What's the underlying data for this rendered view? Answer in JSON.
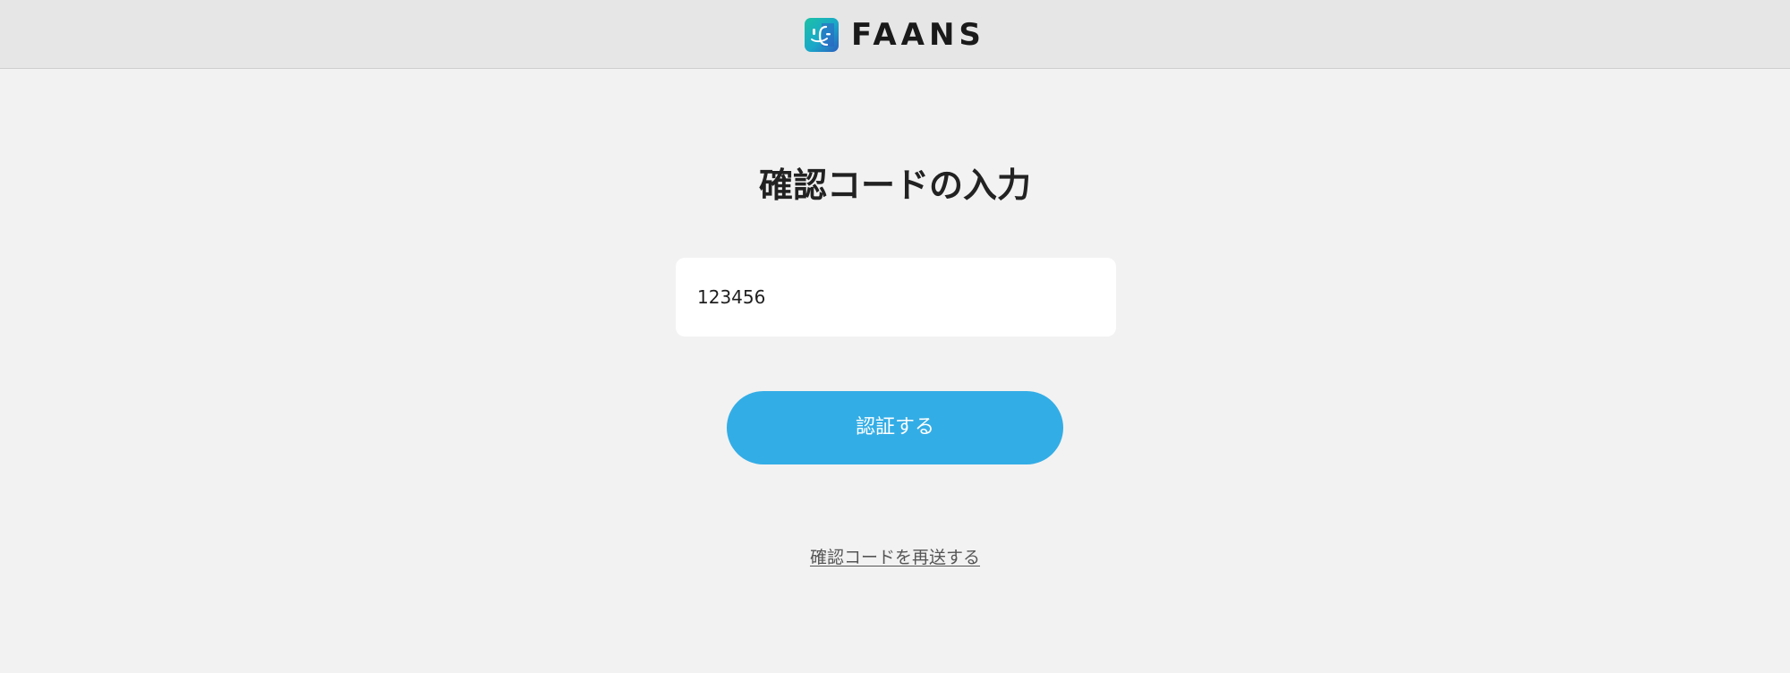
{
  "header": {
    "brand_name": "FAANS",
    "logo_icon": "faans-logo-icon"
  },
  "main": {
    "title": "確認コードの入力",
    "code_input": {
      "value": "123456",
      "placeholder": ""
    },
    "submit_button": {
      "label": "認証する"
    },
    "resend_link": {
      "label": "確認コードを再送する"
    }
  },
  "colors": {
    "background": "#f2f2f2",
    "header_background": "#e6e6e6",
    "accent": "#33ade6",
    "input_background": "#ffffff",
    "text": "#1f1f1f",
    "link_text": "#555555"
  }
}
